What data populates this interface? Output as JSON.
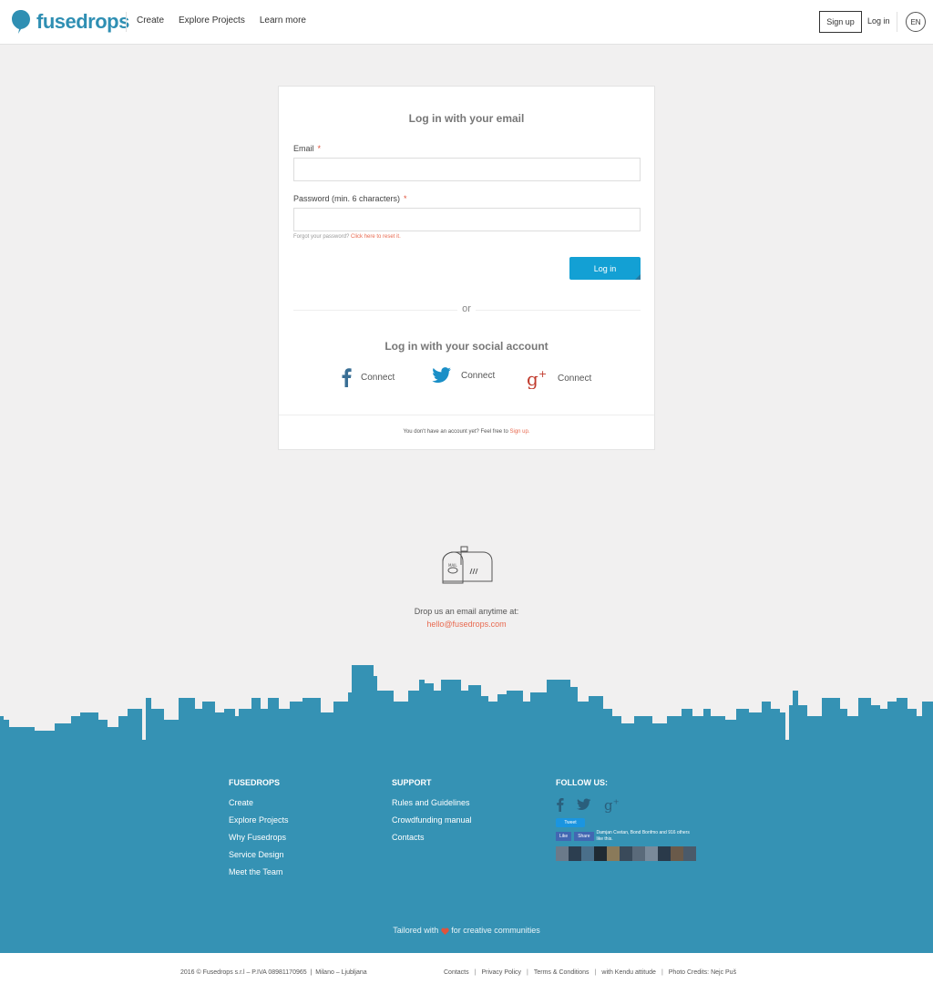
{
  "header": {
    "logo": "fusedrops",
    "nav": [
      "Create",
      "Explore Projects",
      "Learn more"
    ],
    "signup": "Sign up",
    "login": "Log in",
    "lang": "EN"
  },
  "login_card": {
    "email_title": "Log in with your email",
    "email_label": "Email",
    "password_label": "Password (min. 6 characters)",
    "required_mark": "*",
    "forgot_text": "Forgot your password?",
    "forgot_link": "Click here to reset it.",
    "login_button": "Log in",
    "or": "or",
    "social_title": "Log in with your social account",
    "facebook_connect": "Connect",
    "twitter_connect": "Connect",
    "google_connect": "Connect",
    "no_account": "You don't have an account yet? Feel free to",
    "signup_link": "Sign up."
  },
  "contact": {
    "drop_text": "Drop us an email anytime at:",
    "email": "hello@fusedrops.com"
  },
  "footer": {
    "col1_title": "FUSEDROPS",
    "col1_items": [
      "Create",
      "Explore Projects",
      "Why Fusedrops",
      "Service Design",
      "Meet the Team"
    ],
    "col2_title": "SUPPORT",
    "col2_items": [
      "Rules and Guidelines",
      "Crowdfunding manual",
      "Contacts"
    ],
    "col3_title": "FOLLOW US:",
    "tweet": "Tweet",
    "fb_like": "Like",
    "fb_share": "Share",
    "fb_likes_text": "Damjan Cvetan, Bond Bonfmo and 916 others like this.",
    "tailored_pre": "Tailored with",
    "tailored_post": "for creative communities"
  },
  "bottom": {
    "copyright": "2016 © Fusedrops s.r.l – P.IVA 08981170965  |  Milano – Ljubljana",
    "links": [
      "Contacts",
      "Privacy Policy",
      "Terms & Conditions",
      "with Kendu attitude",
      "Photo Credits: Nejc Puš"
    ]
  },
  "colors": {
    "brand": "#2f8fb3",
    "button": "#13a0d4",
    "link": "#e86a50",
    "footer_bg": "#3592b4"
  }
}
